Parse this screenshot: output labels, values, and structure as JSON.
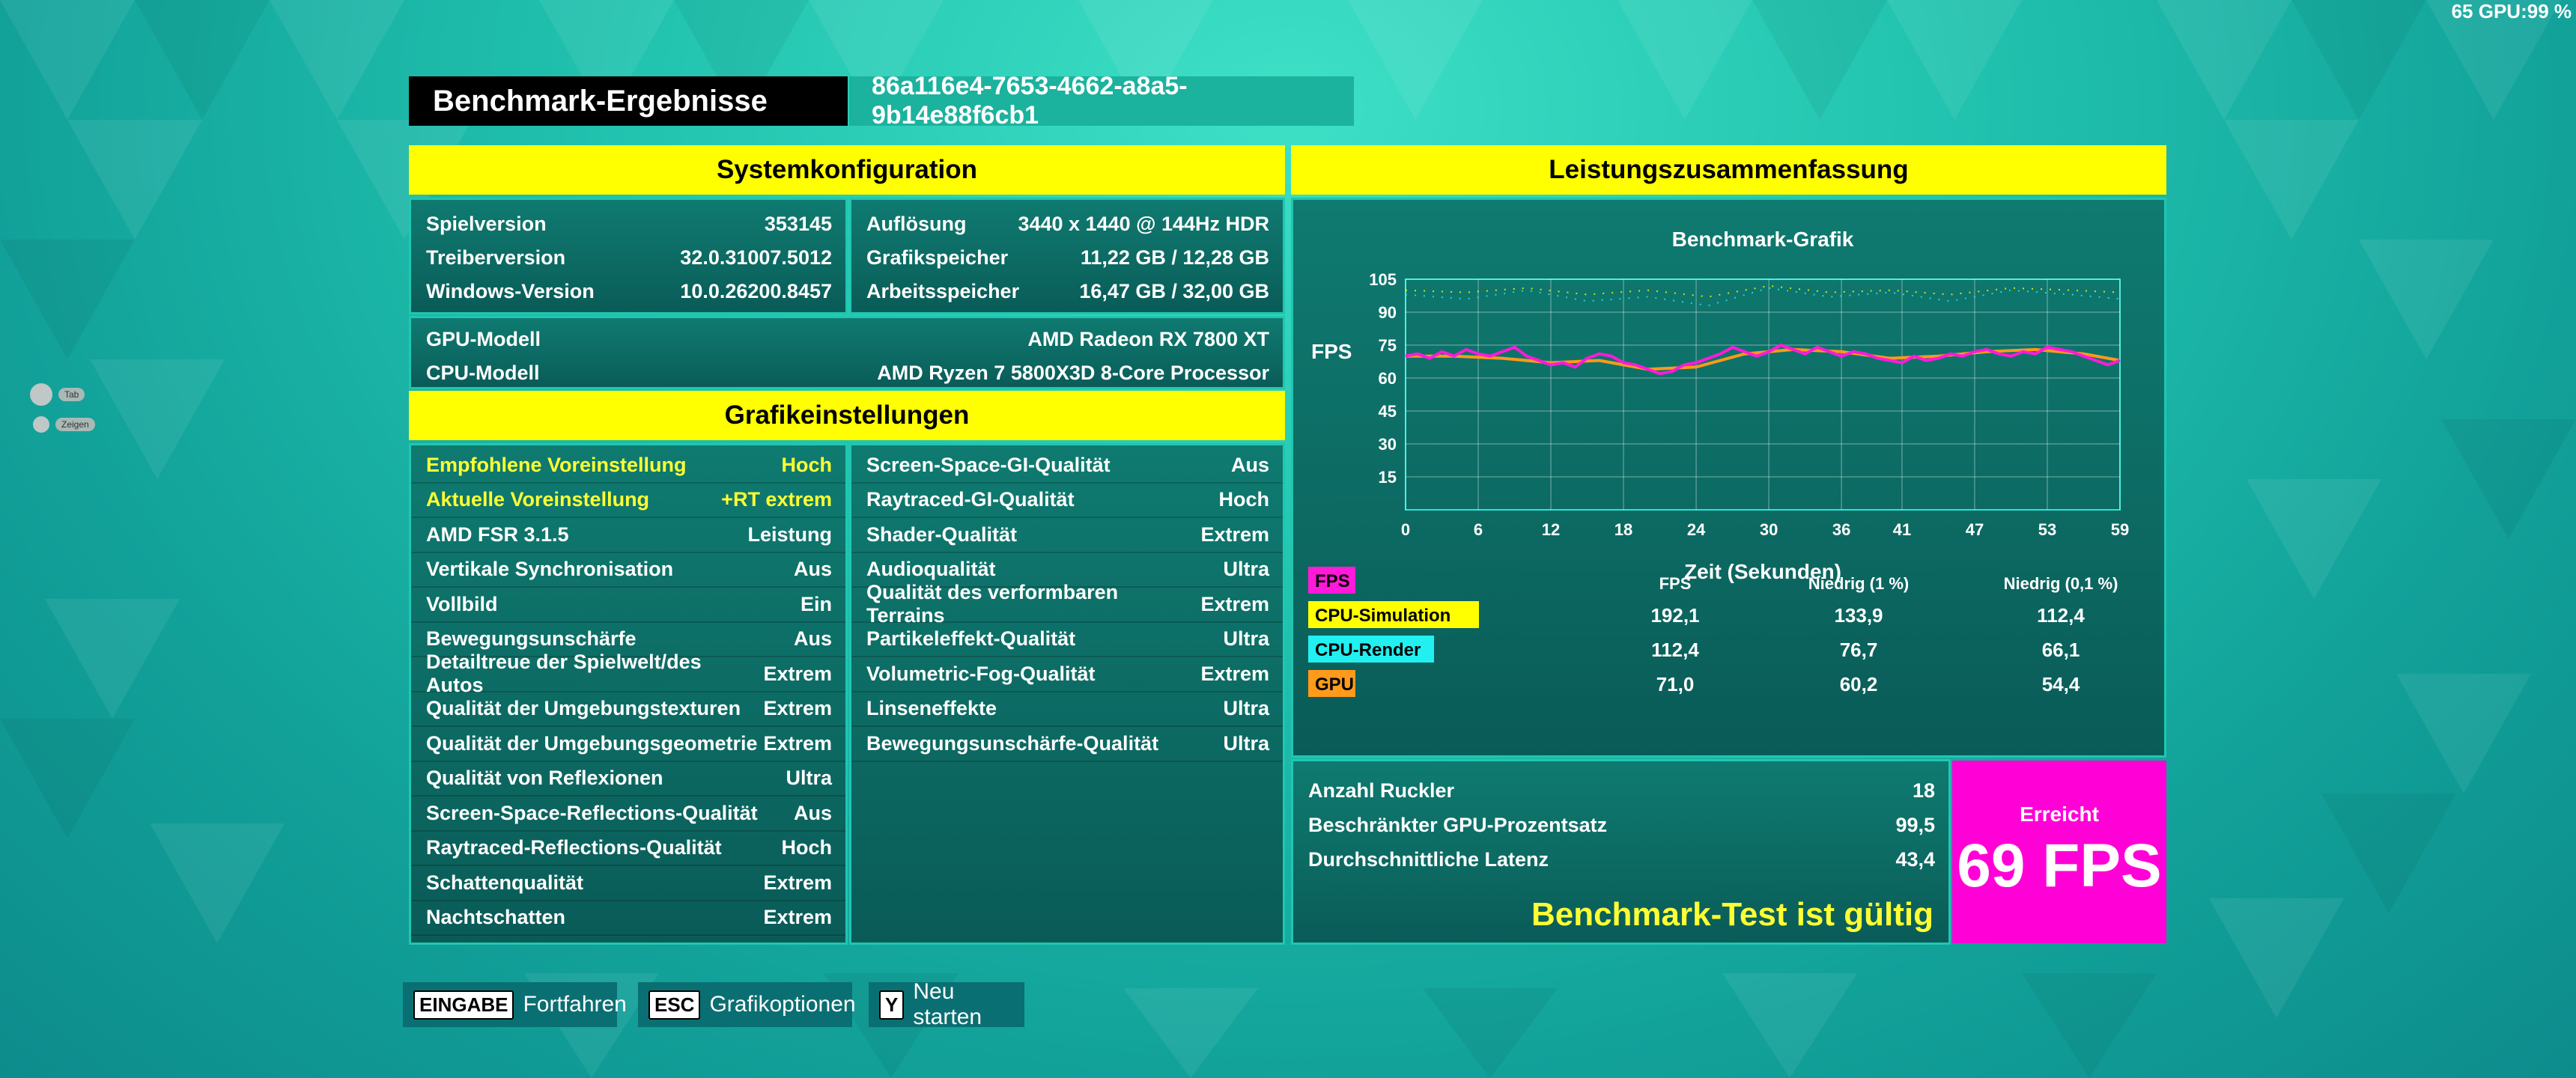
{
  "osd": "65 GPU:99 %",
  "header": {
    "title": "Benchmark-Ergebnisse",
    "run_id": "86a116e4-7653-4662-a8a5-9b14e88f6cb1"
  },
  "system": {
    "heading": "Systemkonfiguration",
    "left": [
      {
        "label": "Spielversion",
        "value": "353145"
      },
      {
        "label": "Treiberversion",
        "value": "32.0.31007.5012"
      },
      {
        "label": "Windows-Version",
        "value": "10.0.26200.8457"
      }
    ],
    "right": [
      {
        "label": "Auflösung",
        "value": "3440 x 1440 @ 144Hz HDR"
      },
      {
        "label": "Grafikspeicher",
        "value": "11,22 GB / 12,28 GB"
      },
      {
        "label": "Arbeitsspeicher",
        "value": "16,47 GB / 32,00 GB"
      }
    ],
    "hw": [
      {
        "label": "GPU-Modell",
        "value": "AMD Radeon RX 7800 XT"
      },
      {
        "label": "CPU-Modell",
        "value": "AMD Ryzen 7 5800X3D 8-Core Processor"
      }
    ]
  },
  "graphics": {
    "heading": "Grafikeinstellungen",
    "left": [
      {
        "label": "Empfohlene Voreinstellung",
        "value": "Hoch"
      },
      {
        "label": "Aktuelle Voreinstellung",
        "value": "+RT extrem"
      },
      {
        "label": "AMD FSR 3.1.5",
        "value": "Leistung"
      },
      {
        "label": "Vertikale Synchronisation",
        "value": "Aus"
      },
      {
        "label": "Vollbild",
        "value": "Ein"
      },
      {
        "label": "Bewegungsunschärfe",
        "value": "Aus"
      },
      {
        "label": "Detailtreue der Spielwelt/des Autos",
        "value": "Extrem"
      },
      {
        "label": "Qualität der Umgebungstexturen",
        "value": "Extrem"
      },
      {
        "label": "Qualität der Umgebungsgeometrie",
        "value": "Extrem"
      },
      {
        "label": "Qualität von Reflexionen",
        "value": "Ultra"
      },
      {
        "label": "Screen-Space-Reflections-Qualität",
        "value": "Aus"
      },
      {
        "label": "Raytraced-Reflections-Qualität",
        "value": "Hoch"
      },
      {
        "label": "Schattenqualität",
        "value": "Extrem"
      },
      {
        "label": "Nachtschatten",
        "value": "Extrem"
      }
    ],
    "right": [
      {
        "label": "Screen-Space-GI-Qualität",
        "value": "Aus"
      },
      {
        "label": "Raytraced-GI-Qualität",
        "value": "Hoch"
      },
      {
        "label": "Shader-Qualität",
        "value": "Extrem"
      },
      {
        "label": "Audioqualität",
        "value": "Ultra"
      },
      {
        "label": "Qualität des verformbaren Terrains",
        "value": "Extrem"
      },
      {
        "label": "Partikeleffekt-Qualität",
        "value": "Ultra"
      },
      {
        "label": "Volumetric-Fog-Qualität",
        "value": "Extrem"
      },
      {
        "label": "Linseneffekte",
        "value": "Ultra"
      },
      {
        "label": "Bewegungsunschärfe-Qualität",
        "value": "Ultra"
      }
    ]
  },
  "summary": {
    "heading": "Leistungszusammenfassung",
    "table_headers": [
      "FPS",
      "Niedrig (1 %)",
      "Niedrig (0,1 %)"
    ],
    "rows": [
      {
        "name": "FPS",
        "color": "#ff1ad9",
        "fps": "",
        "low1": "",
        "low01": ""
      },
      {
        "name": "CPU-Simulation",
        "color": "#ffff00",
        "fps": "192,1",
        "low1": "133,9",
        "low01": "112,4"
      },
      {
        "name": "CPU-Render",
        "color": "#22f0f0",
        "fps": "112,4",
        "low1": "76,7",
        "low01": "66,1"
      },
      {
        "name": "GPU",
        "color": "#ff9a1a",
        "fps": "71,0",
        "low1": "60,2",
        "low01": "54,4"
      }
    ],
    "extra": [
      {
        "label": "Anzahl Ruckler",
        "value": "18"
      },
      {
        "label": "Beschränkter GPU-Prozentsatz",
        "value": "99,5"
      },
      {
        "label": "Durchschnittliche Latenz",
        "value": "43,4"
      }
    ],
    "valid_text": "Benchmark-Test ist gültig",
    "achieved_label": "Erreicht",
    "achieved_value": "69 FPS"
  },
  "chart_data": {
    "type": "line",
    "title": "Benchmark-Grafik",
    "xlabel": "Zeit (Sekunden)",
    "ylabel": "FPS",
    "x_ticks": [
      "0",
      "6",
      "12",
      "18",
      "24",
      "30",
      "36",
      "41",
      "47",
      "53",
      "59"
    ],
    "y_ticks": [
      "15",
      "30",
      "45",
      "60",
      "75",
      "90",
      "105"
    ],
    "xlim": [
      0,
      59
    ],
    "ylim": [
      0,
      105
    ],
    "grid": true,
    "series": [
      {
        "name": "FPS",
        "color": "#ff1ad9",
        "x": [
          0,
          1,
          2,
          3,
          4,
          5,
          6,
          7,
          8,
          9,
          10,
          11,
          12,
          13,
          14,
          15,
          16,
          17,
          18,
          19,
          20,
          21,
          22,
          23,
          24,
          25,
          26,
          27,
          28,
          29,
          30,
          31,
          32,
          33,
          34,
          35,
          36,
          37,
          38,
          39,
          40,
          41,
          42,
          43,
          44,
          45,
          46,
          47,
          48,
          49,
          50,
          51,
          52,
          53,
          54,
          55,
          56,
          57,
          58,
          59
        ],
        "y": [
          70,
          71,
          69,
          72,
          70,
          73,
          71,
          70,
          72,
          74,
          70,
          68,
          66,
          67,
          65,
          69,
          71,
          70,
          67,
          66,
          64,
          62,
          63,
          66,
          67,
          69,
          71,
          74,
          72,
          70,
          72,
          75,
          73,
          71,
          74,
          72,
          70,
          72,
          71,
          69,
          68,
          67,
          70,
          68,
          69,
          71,
          70,
          72,
          73,
          71,
          70,
          72,
          71,
          74,
          73,
          72,
          70,
          68,
          66,
          68
        ]
      },
      {
        "name": "CPU-Simulation",
        "color": "#ffff00",
        "x": [
          0,
          5,
          10,
          15,
          20,
          25,
          30,
          35,
          40,
          45,
          50,
          55,
          59
        ],
        "y": [
          100,
          99,
          101,
          98,
          100,
          97,
          102,
          99,
          100,
          98,
          101,
          100,
          99
        ]
      },
      {
        "name": "CPU-Render",
        "color": "#22f0f0",
        "x": [
          0,
          5,
          10,
          15,
          20,
          25,
          30,
          35,
          40,
          45,
          50,
          55,
          59
        ],
        "y": [
          98,
          96,
          100,
          95,
          97,
          93,
          101,
          97,
          99,
          95,
          100,
          98,
          96
        ]
      },
      {
        "name": "GPU",
        "color": "#ff9a1a",
        "x": [
          0,
          4,
          8,
          12,
          16,
          20,
          24,
          28,
          32,
          36,
          40,
          44,
          48,
          52,
          56,
          59
        ],
        "y": [
          70,
          70,
          69,
          67,
          68,
          64,
          65,
          71,
          73,
          72,
          69,
          70,
          72,
          73,
          71,
          68
        ]
      }
    ]
  },
  "buttons": [
    {
      "key": "EINGABE",
      "label": "Fortfahren"
    },
    {
      "key": "ESC",
      "label": "Grafikoptionen"
    },
    {
      "key": "Y",
      "label": "Neu starten"
    }
  ],
  "side": {
    "pill1": "Tab",
    "pill2": "Zeigen"
  }
}
